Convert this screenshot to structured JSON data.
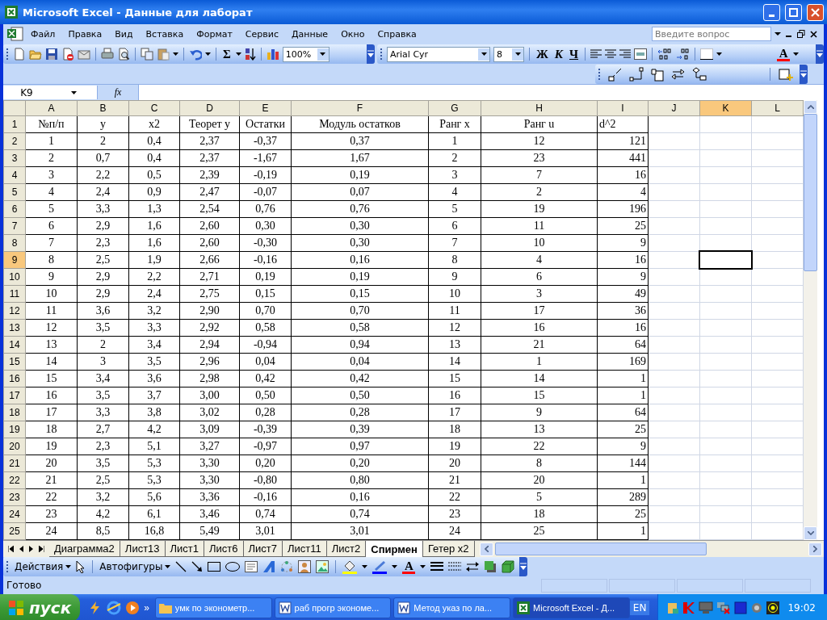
{
  "window": {
    "title": "Microsoft Excel - Данные для лаборат"
  },
  "menu": {
    "items": [
      "Файл",
      "Правка",
      "Вид",
      "Вставка",
      "Формат",
      "Сервис",
      "Данные",
      "Окно",
      "Справка"
    ],
    "help_placeholder": "Введите вопрос"
  },
  "standard_toolbar": {
    "sum_label": "Σ",
    "zoom": "100%"
  },
  "formatting_toolbar": {
    "font": "Arial Cyr",
    "size": "8",
    "style_buttons": [
      "Ж",
      "К",
      "Ч"
    ],
    "font_color_label": "A"
  },
  "formula_bar": {
    "name_box": "K9",
    "function_label": "fx"
  },
  "sheet": {
    "columns": [
      {
        "label": "A",
        "selected": false
      },
      {
        "label": "B",
        "selected": false
      },
      {
        "label": "C",
        "selected": false
      },
      {
        "label": "D",
        "selected": false
      },
      {
        "label": "E",
        "selected": false
      },
      {
        "label": "F",
        "selected": false
      },
      {
        "label": "G",
        "selected": false
      },
      {
        "label": "H",
        "selected": false
      },
      {
        "label": "I",
        "selected": false
      },
      {
        "label": "J",
        "selected": false
      },
      {
        "label": "K",
        "selected": true
      },
      {
        "label": "L",
        "selected": false
      }
    ],
    "rows": [
      {
        "number": "1",
        "selected": false,
        "cells": [
          "№п/п",
          "y",
          "x2",
          "Теорет y",
          "Остатки",
          "Модуль остатков",
          "Ранг x",
          "Ранг u",
          "d^2"
        ]
      },
      {
        "number": "2",
        "selected": false,
        "cells": [
          "1",
          "2",
          "0,4",
          "2,37",
          "-0,37",
          "0,37",
          "1",
          "12",
          "121"
        ]
      },
      {
        "number": "3",
        "selected": false,
        "cells": [
          "2",
          "0,7",
          "0,4",
          "2,37",
          "-1,67",
          "1,67",
          "2",
          "23",
          "441"
        ]
      },
      {
        "number": "4",
        "selected": false,
        "cells": [
          "3",
          "2,2",
          "0,5",
          "2,39",
          "-0,19",
          "0,19",
          "3",
          "7",
          "16"
        ]
      },
      {
        "number": "5",
        "selected": false,
        "cells": [
          "4",
          "2,4",
          "0,9",
          "2,47",
          "-0,07",
          "0,07",
          "4",
          "2",
          "4"
        ]
      },
      {
        "number": "6",
        "selected": false,
        "cells": [
          "5",
          "3,3",
          "1,3",
          "2,54",
          "0,76",
          "0,76",
          "5",
          "19",
          "196"
        ]
      },
      {
        "number": "7",
        "selected": false,
        "cells": [
          "6",
          "2,9",
          "1,6",
          "2,60",
          "0,30",
          "0,30",
          "6",
          "11",
          "25"
        ]
      },
      {
        "number": "8",
        "selected": false,
        "cells": [
          "7",
          "2,3",
          "1,6",
          "2,60",
          "-0,30",
          "0,30",
          "7",
          "10",
          "9"
        ]
      },
      {
        "number": "9",
        "selected": true,
        "cells": [
          "8",
          "2,5",
          "1,9",
          "2,66",
          "-0,16",
          "0,16",
          "8",
          "4",
          "16"
        ]
      },
      {
        "number": "10",
        "selected": false,
        "cells": [
          "9",
          "2,9",
          "2,2",
          "2,71",
          "0,19",
          "0,19",
          "9",
          "6",
          "9"
        ]
      },
      {
        "number": "11",
        "selected": false,
        "cells": [
          "10",
          "2,9",
          "2,4",
          "2,75",
          "0,15",
          "0,15",
          "10",
          "3",
          "49"
        ]
      },
      {
        "number": "12",
        "selected": false,
        "cells": [
          "11",
          "3,6",
          "3,2",
          "2,90",
          "0,70",
          "0,70",
          "11",
          "17",
          "36"
        ]
      },
      {
        "number": "13",
        "selected": false,
        "cells": [
          "12",
          "3,5",
          "3,3",
          "2,92",
          "0,58",
          "0,58",
          "12",
          "16",
          "16"
        ]
      },
      {
        "number": "14",
        "selected": false,
        "cells": [
          "13",
          "2",
          "3,4",
          "2,94",
          "-0,94",
          "0,94",
          "13",
          "21",
          "64"
        ]
      },
      {
        "number": "15",
        "selected": false,
        "cells": [
          "14",
          "3",
          "3,5",
          "2,96",
          "0,04",
          "0,04",
          "14",
          "1",
          "169"
        ]
      },
      {
        "number": "16",
        "selected": false,
        "cells": [
          "15",
          "3,4",
          "3,6",
          "2,98",
          "0,42",
          "0,42",
          "15",
          "14",
          "1"
        ]
      },
      {
        "number": "17",
        "selected": false,
        "cells": [
          "16",
          "3,5",
          "3,7",
          "3,00",
          "0,50",
          "0,50",
          "16",
          "15",
          "1"
        ]
      },
      {
        "number": "18",
        "selected": false,
        "cells": [
          "17",
          "3,3",
          "3,8",
          "3,02",
          "0,28",
          "0,28",
          "17",
          "9",
          "64"
        ]
      },
      {
        "number": "19",
        "selected": false,
        "cells": [
          "18",
          "2,7",
          "4,2",
          "3,09",
          "-0,39",
          "0,39",
          "18",
          "13",
          "25"
        ]
      },
      {
        "number": "20",
        "selected": false,
        "cells": [
          "19",
          "2,3",
          "5,1",
          "3,27",
          "-0,97",
          "0,97",
          "19",
          "22",
          "9"
        ]
      },
      {
        "number": "21",
        "selected": false,
        "cells": [
          "20",
          "3,5",
          "5,3",
          "3,30",
          "0,20",
          "0,20",
          "20",
          "8",
          "144"
        ]
      },
      {
        "number": "22",
        "selected": false,
        "cells": [
          "21",
          "2,5",
          "5,3",
          "3,30",
          "-0,80",
          "0,80",
          "21",
          "20",
          "1"
        ]
      },
      {
        "number": "23",
        "selected": false,
        "cells": [
          "22",
          "3,2",
          "5,6",
          "3,36",
          "-0,16",
          "0,16",
          "22",
          "5",
          "289"
        ]
      },
      {
        "number": "24",
        "selected": false,
        "cells": [
          "23",
          "4,2",
          "6,1",
          "3,46",
          "0,74",
          "0,74",
          "23",
          "18",
          "25"
        ]
      },
      {
        "number": "25",
        "selected": false,
        "cells": [
          "24",
          "8,5",
          "16,8",
          "5,49",
          "3,01",
          "3,01",
          "24",
          "25",
          "1"
        ]
      }
    ]
  },
  "sheet_tabs": [
    {
      "label": "Диаграмма2",
      "selected": false
    },
    {
      "label": "Лист13",
      "selected": false
    },
    {
      "label": "Лист1",
      "selected": false
    },
    {
      "label": "Лист6",
      "selected": false
    },
    {
      "label": "Лист7",
      "selected": false
    },
    {
      "label": "Лист11",
      "selected": false
    },
    {
      "label": "Лист2",
      "selected": false
    },
    {
      "label": "Спирмен",
      "selected": true
    },
    {
      "label": "Гетер x2",
      "selected": false
    }
  ],
  "drawing_toolbar": {
    "actions": "Действия",
    "autoshapes": "Автофигуры",
    "font_color_label": "A"
  },
  "status_bar": {
    "text": "Готово"
  },
  "taskbar": {
    "start": "пуск",
    "more": "»",
    "tasks": [
      {
        "label": "умк по эконометр...",
        "kind": "folder",
        "selected": false
      },
      {
        "label": "раб прогр экономе...",
        "kind": "word",
        "selected": false
      },
      {
        "label": "Метод указ по ла...",
        "kind": "word",
        "selected": false
      },
      {
        "label": "Microsoft Excel - Д...",
        "kind": "excel",
        "selected": true
      }
    ],
    "language": "EN",
    "clock": "19:02"
  }
}
